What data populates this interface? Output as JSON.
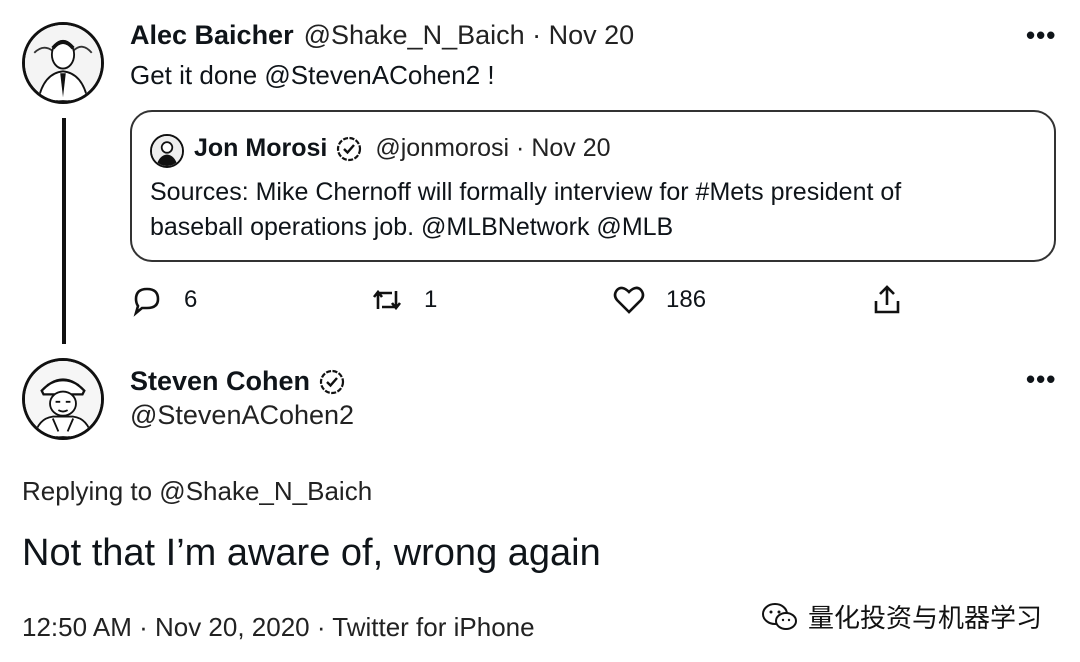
{
  "parent_tweet": {
    "author_name": "Alec Baicher",
    "handle_and_date": "@Shake_N_Baich · Nov 20",
    "text": "Get it done @StevenACohen2 !",
    "quote": {
      "author_name": "Jon Morosi",
      "handle_and_date": "@jonmorosi · Nov 20",
      "text_line1": "Sources: Mike Chernoff will formally interview for #Mets president of",
      "text_line2": "baseball operations job. @MLBNetwork @MLB"
    },
    "actions": {
      "reply_count": "6",
      "retweet_count": "1",
      "like_count": "186"
    },
    "more_label": "•••"
  },
  "main_tweet": {
    "author_name": "Steven Cohen",
    "handle": "@StevenACohen2",
    "replying_to": "Replying to @Shake_N_Baich",
    "text": "Not that I’m aware of, wrong again",
    "meta": "12:50 AM · Nov 20, 2020 · Twitter for iPhone",
    "more_label": "•••"
  },
  "watermark": {
    "text": "量化投资与机器学习",
    "icon": "wechat-icon"
  },
  "icons": {
    "verified": "verified-badge-icon",
    "reply": "reply-icon",
    "retweet": "retweet-icon",
    "like": "heart-icon",
    "share": "share-icon"
  }
}
